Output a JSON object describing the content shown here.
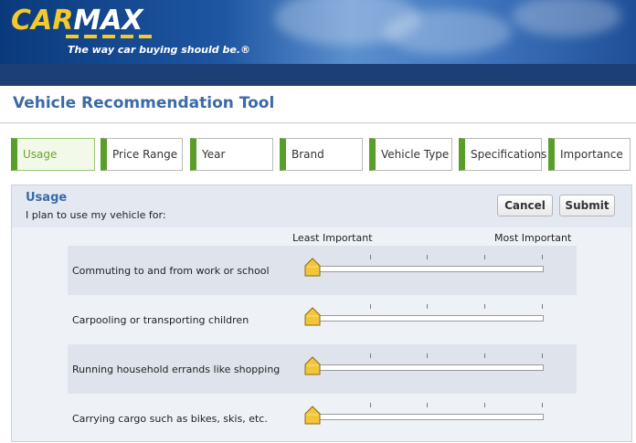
{
  "brand": {
    "logo_car": "CAR",
    "logo_max": "MAX",
    "tagline": "The way car buying should be.®"
  },
  "page": {
    "title": "Vehicle Recommendation Tool"
  },
  "steps": [
    {
      "label": "Usage",
      "active": true
    },
    {
      "label": "Price Range",
      "active": false
    },
    {
      "label": "Year",
      "active": false
    },
    {
      "label": "Brand",
      "active": false
    },
    {
      "label": "Vehicle Type",
      "active": false
    },
    {
      "label": "Specifications",
      "active": false
    },
    {
      "label": "Importance",
      "active": false
    }
  ],
  "panel": {
    "title": "Usage",
    "subtitle": "I plan to use my vehicle for:",
    "cancel_label": "Cancel",
    "submit_label": "Submit",
    "scale_least": "Least Important",
    "scale_most": "Most Important",
    "items": [
      {
        "label": "Commuting to and from work or school",
        "level": 0
      },
      {
        "label": "Carpooling or transporting children",
        "level": 0
      },
      {
        "label": "Running household errands like shopping",
        "level": 0
      },
      {
        "label": "Carrying cargo such as bikes, skis, etc.",
        "level": 0
      }
    ]
  },
  "colors": {
    "accent_green": "#5a9e2a",
    "title_blue": "#3a6aa8",
    "brand_yellow": "#f4c92b",
    "header_navy": "#1c3f75"
  }
}
